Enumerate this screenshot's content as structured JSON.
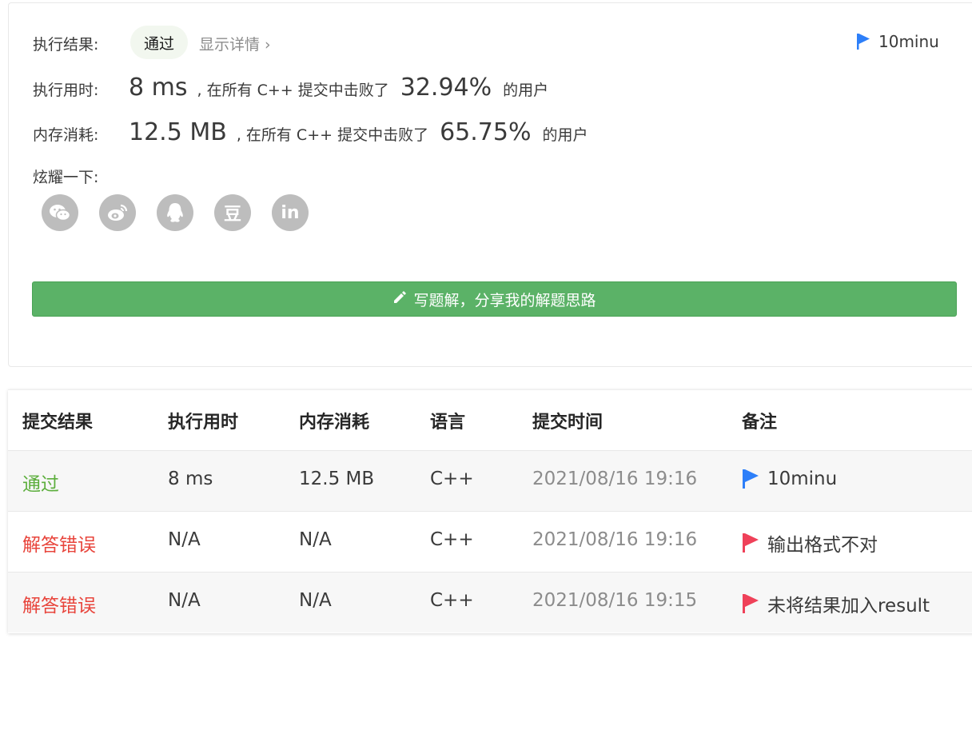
{
  "result": {
    "label": "执行结果:",
    "status": "通过",
    "detail_link": "显示详情 ›",
    "note": "10minu",
    "note_color": "#2d7ff9"
  },
  "runtime": {
    "label": "执行用时:",
    "value": "8 ms",
    "middle": ", 在所有 C++ 提交中击败了",
    "percent": "32.94%",
    "tail": "的用户"
  },
  "memory": {
    "label": "内存消耗:",
    "value": "12.5 MB",
    "middle": ", 在所有 C++ 提交中击败了",
    "percent": "65.75%",
    "tail": "的用户"
  },
  "share": {
    "label": "炫耀一下:",
    "icons": [
      "wechat-icon",
      "weibo-icon",
      "qq-icon",
      "douban-icon",
      "linkedin-icon"
    ],
    "douban_text": "豆",
    "linkedin_text": "in"
  },
  "solution_button": {
    "label": "写题解，分享我的解题思路",
    "color": "#5bb267"
  },
  "table": {
    "headers": [
      "提交结果",
      "执行用时",
      "内存消耗",
      "语言",
      "提交时间",
      "备注"
    ],
    "rows": [
      {
        "result": "通过",
        "runtime": "8 ms",
        "memory": "12.5 MB",
        "lang": "C++",
        "time": "2021/08/16 19:16",
        "note": "10minu",
        "status": "ok",
        "flag_color": "#2d7ff9"
      },
      {
        "result": "解答错误",
        "runtime": "N/A",
        "memory": "N/A",
        "lang": "C++",
        "time": "2021/08/16 19:16",
        "note": "输出格式不对",
        "status": "err",
        "flag_color": "#ef4159"
      },
      {
        "result": "解答错误",
        "runtime": "N/A",
        "memory": "N/A",
        "lang": "C++",
        "time": "2021/08/16 19:15",
        "note": "未将结果加入result",
        "status": "err",
        "flag_color": "#ef4159"
      }
    ]
  }
}
